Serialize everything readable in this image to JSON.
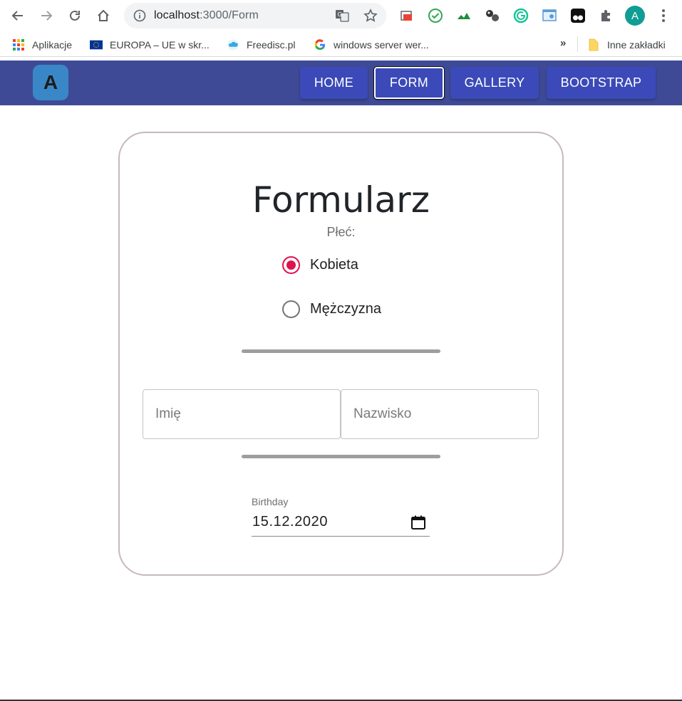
{
  "browser": {
    "url_host": "localhost",
    "url_port_path": ":3000/Form",
    "profile_initial": "A",
    "bookmarks": [
      {
        "label": "Aplikacje",
        "icon": "apps-grid-icon"
      },
      {
        "label": "EUROPA – UE w skr...",
        "icon": "eu-flag-icon"
      },
      {
        "label": "Freedisc.pl",
        "icon": "cloud-icon"
      },
      {
        "label": "windows server wer...",
        "icon": "google-icon"
      }
    ],
    "overflow_chevron": "»",
    "other_bookmarks": "Inne zakładki"
  },
  "navbar": {
    "logo_letter": "A",
    "items": [
      {
        "label": "HOME",
        "active": false
      },
      {
        "label": "FORM",
        "active": true
      },
      {
        "label": "GALLERY",
        "active": false
      },
      {
        "label": "BOOTSTRAP",
        "active": false
      }
    ]
  },
  "form": {
    "title": "Formularz",
    "gender_label": "Płeć:",
    "options": [
      {
        "label": "Kobieta",
        "checked": true
      },
      {
        "label": "Mężczyzna",
        "checked": false
      }
    ],
    "first_name": {
      "value": "",
      "placeholder": "Imię"
    },
    "last_name": {
      "value": "",
      "placeholder": "Nazwisko"
    },
    "birthday_label": "Birthday",
    "birthday_value": "15.12.2020"
  },
  "colors": {
    "navbar_bg": "#3f4a96",
    "nav_button": "#3b4ab8",
    "radio_accent": "#e0124f",
    "card_border": "#c7b8bc"
  }
}
